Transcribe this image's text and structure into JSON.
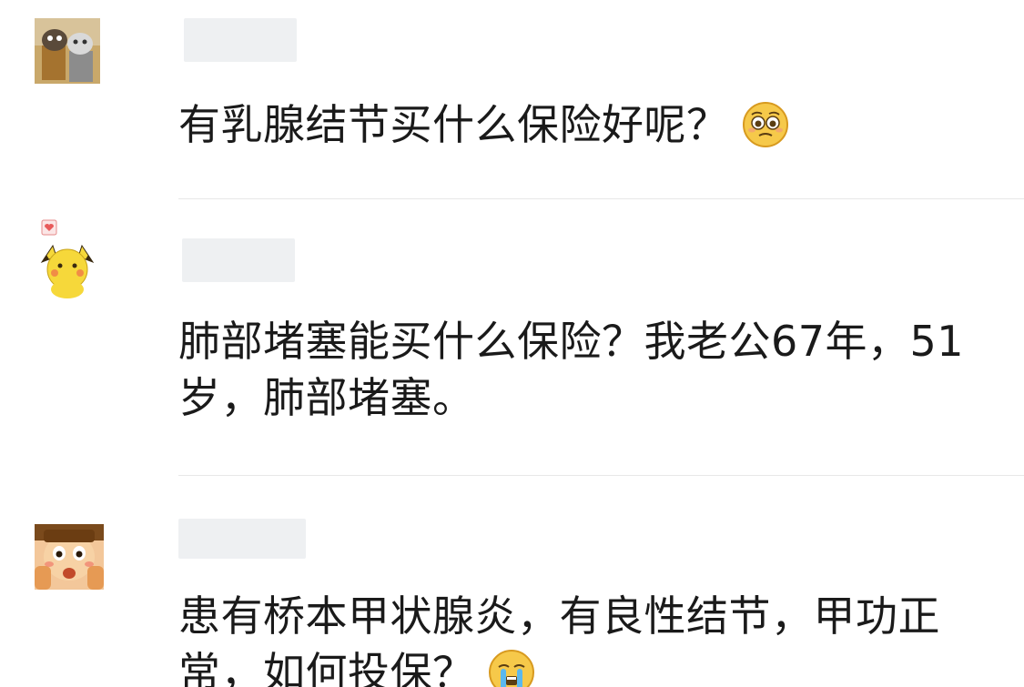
{
  "comments": [
    {
      "text": "有乳腺结节买什么保险好呢？",
      "emoji": "pleading-face-icon"
    },
    {
      "text": "肺部堵塞能买什么保险？我老公67年，51岁，肺部堵塞。",
      "line1": "肺部堵塞能买什么保险？我老公67年，51",
      "line2": "岁，肺部堵塞。"
    },
    {
      "text": "患有桥本甲状腺炎，有良性结节，甲功正常，如何投保？",
      "line1": "患有桥本甲状腺炎，有良性结节，甲功正",
      "line2": "常，如何投保？",
      "emoji": "crying-face-icon"
    }
  ],
  "colors": {
    "text": "#1a1a1a",
    "divider": "#e8e8e8",
    "name_placeholder": "#eef0f2"
  }
}
